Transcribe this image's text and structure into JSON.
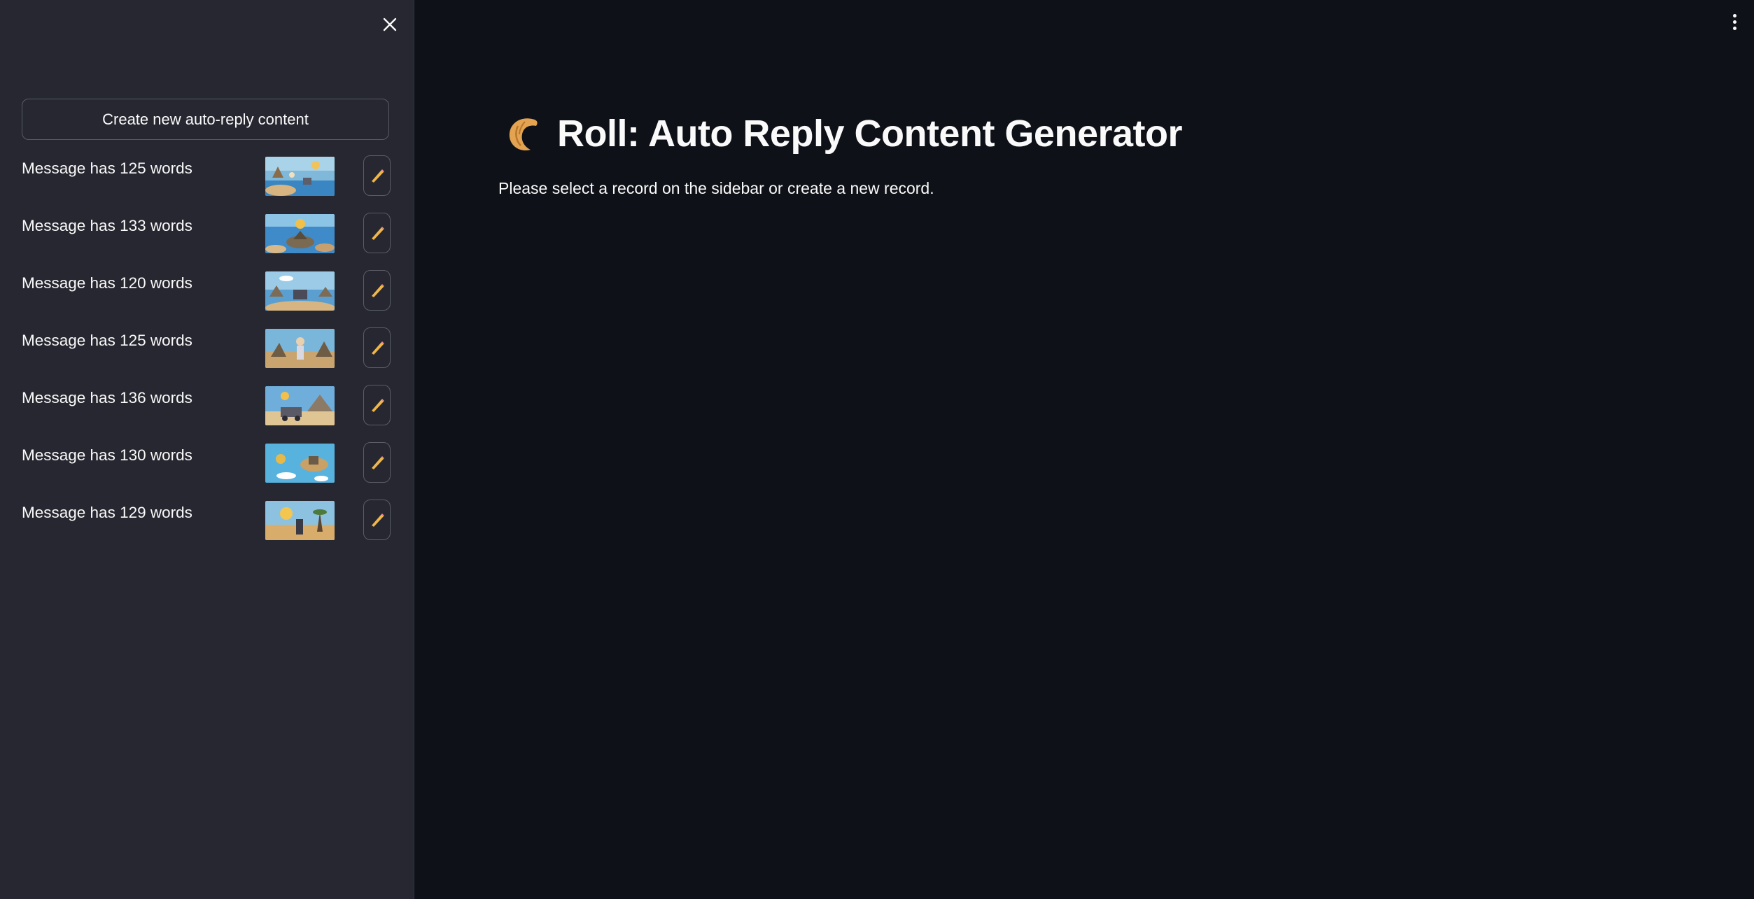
{
  "sidebar": {
    "close_icon": "close-icon",
    "new_button_label": "Create new auto-reply content",
    "records": [
      {
        "label": "Message has 125 words",
        "thumb": "beach-scene-1",
        "edit_icon": "pencil-icon"
      },
      {
        "label": "Message has 133 words",
        "thumb": "beach-scene-2",
        "edit_icon": "pencil-icon"
      },
      {
        "label": "Message has 120 words",
        "thumb": "beach-scene-3",
        "edit_icon": "pencil-icon"
      },
      {
        "label": "Message has 125 words",
        "thumb": "beach-scene-4",
        "edit_icon": "pencil-icon"
      },
      {
        "label": "Message has 136 words",
        "thumb": "beach-scene-5",
        "edit_icon": "pencil-icon"
      },
      {
        "label": "Message has 130 words",
        "thumb": "beach-scene-6",
        "edit_icon": "pencil-icon"
      },
      {
        "label": "Message has 129 words",
        "thumb": "beach-scene-7",
        "edit_icon": "pencil-icon"
      }
    ]
  },
  "main": {
    "menu_icon": "kebab-menu-icon",
    "title_icon": "croissant-icon",
    "title": "Roll: Auto Reply Content Generator",
    "subtitle": "Please select a record on the sidebar or create a new record."
  },
  "colors": {
    "background": "#0e1117",
    "sidebar": "#262730",
    "text": "#fafafa",
    "accent": "#e8a04a"
  }
}
